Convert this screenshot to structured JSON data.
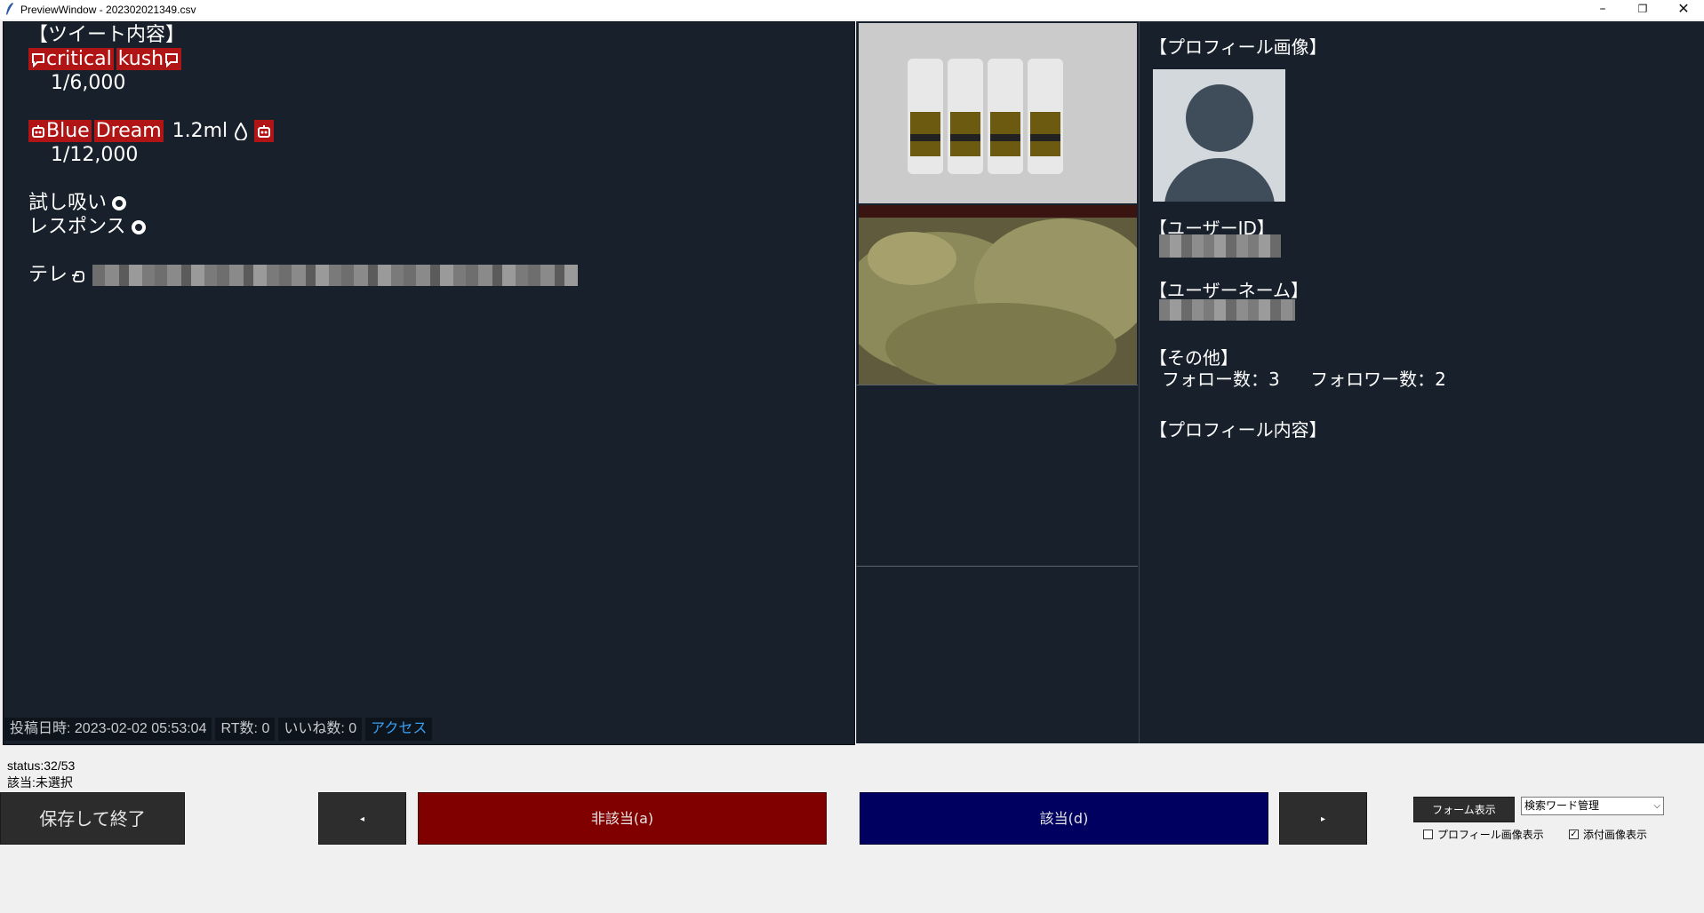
{
  "window": {
    "title": "PreviewWindow - 202302021349.csv",
    "min_glyph": "–",
    "max_glyph": "❐",
    "close_glyph": "✕"
  },
  "tweet": {
    "header": "【ツイート内容】",
    "line1": [
      "critical",
      "kush"
    ],
    "line2": "1/6,000",
    "line3_hl1": "Blue",
    "line3_hl2": "Dream",
    "line3_text": "1.2ml",
    "line4": "1/12,000",
    "line5": "試し吸い",
    "line6": "レスポンス",
    "line7": "テレ"
  },
  "tweet_status": {
    "posted_label": "投稿日時:",
    "posted_value": "2023-02-02 05:53:04",
    "rt_label": "RT数:",
    "rt_value": "0",
    "like_label": "いいね数:",
    "like_value": "0",
    "access_link": "アクセス"
  },
  "profile": {
    "image_header": "【プロフィール画像】",
    "user_id_header": "【ユーザーID】",
    "user_name_header": "【ユーザーネーム】",
    "other_header": "【その他】",
    "follow_label": "フォロー数：",
    "follow_value": "3",
    "follower_label": "フォロワー数：",
    "follower_value": "2",
    "content_header": "【プロフィール内容】"
  },
  "bottom": {
    "status_line": "status:32/53",
    "applicable_line": "該当:未選択",
    "save_button": "保存して終了",
    "prev_button": "◂",
    "next_button": "▸",
    "no_button": "非該当(a)",
    "yes_button": "該当(d)",
    "form_button": "フォーム表示",
    "combo_value": "検索ワード管理",
    "profile_img_checkbox": "プロフィール画像表示",
    "profile_img_checked": false,
    "attach_img_checkbox": "添付画像表示",
    "attach_img_checked": true
  },
  "colors": {
    "panel_bg": "#17202b",
    "no_button": "#800000",
    "yes_button": "#000060",
    "highlight": "#b01414",
    "link": "#3a9ff2"
  }
}
